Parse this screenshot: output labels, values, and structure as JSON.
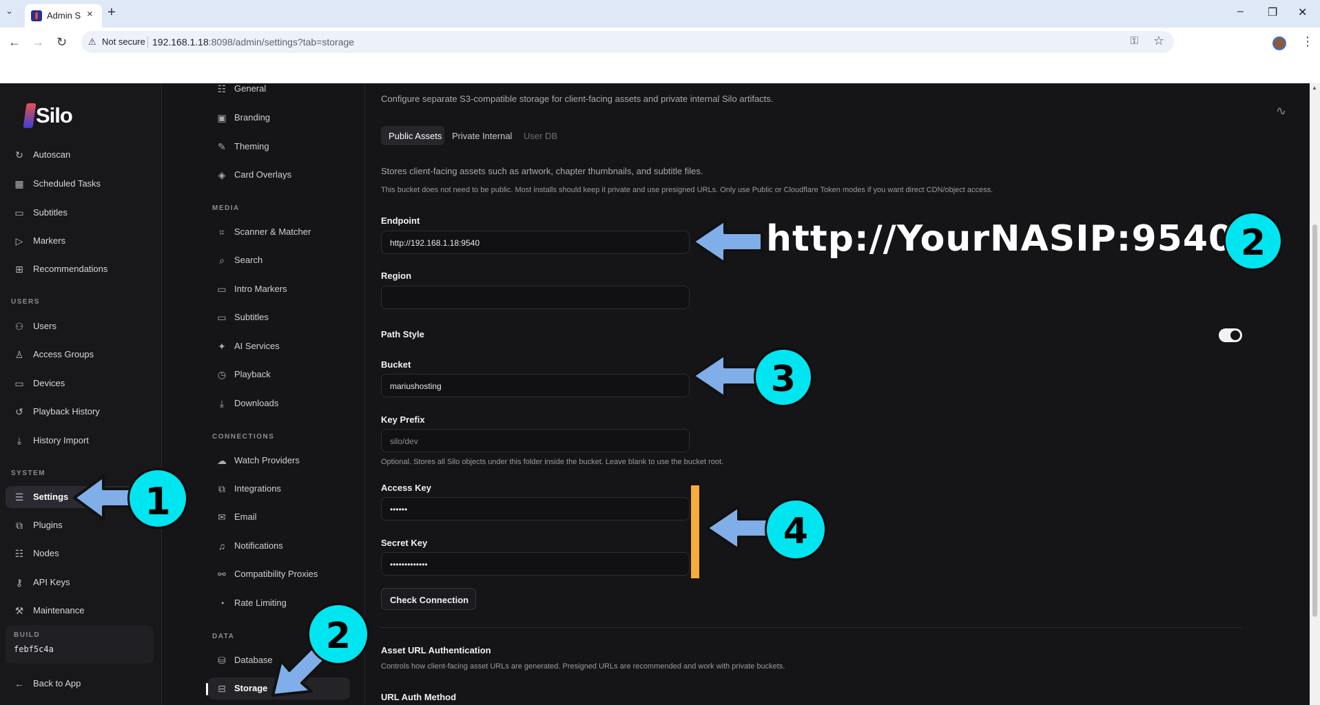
{
  "browser": {
    "tab_title": "Admin Si",
    "security_label": "Not secure",
    "url_host": "192.168.1.18",
    "url_rest": ":8098/admin/settings?tab=storage"
  },
  "app": {
    "brand": "Silo",
    "nav_items": [
      "Autoscan",
      "Scheduled Tasks",
      "Subtitles",
      "Markers",
      "Recommendations"
    ],
    "users_heading": "USERS",
    "users_items": [
      "Users",
      "Access Groups",
      "Devices",
      "Playback History",
      "History Import"
    ],
    "system_heading": "SYSTEM",
    "system_items": [
      "Settings",
      "Plugins",
      "Nodes",
      "API Keys",
      "Maintenance"
    ],
    "build_label": "BUILD",
    "build_value": "febf5c4a",
    "back_label": "Back to App"
  },
  "settings_nav": {
    "general_items": [
      "General",
      "Branding",
      "Theming",
      "Card Overlays"
    ],
    "media_heading": "MEDIA",
    "media_items": [
      "Scanner & Matcher",
      "Search",
      "Intro Markers",
      "Subtitles",
      "AI Services",
      "Playback",
      "Downloads"
    ],
    "connections_heading": "CONNECTIONS",
    "connections_items": [
      "Watch Providers",
      "Integrations",
      "Email",
      "Notifications",
      "Compatibility Proxies",
      "Rate Limiting"
    ],
    "data_heading": "DATA",
    "data_items": [
      "Database",
      "Storage"
    ]
  },
  "storage": {
    "intro": "Configure separate S3-compatible storage for client-facing assets and private internal Silo artifacts.",
    "tabs": [
      "Public Assets",
      "Private Internal",
      "User DB"
    ],
    "desc1": "Stores client-facing assets such as artwork, chapter thumbnails, and subtitle files.",
    "desc2": "This bucket does not need to be public. Most installs should keep it private and use presigned URLs. Only use Public or Cloudflare Token modes if you want direct CDN/object access.",
    "endpoint_label": "Endpoint",
    "endpoint_value": "http://192.168.1.18:9540",
    "region_label": "Region",
    "region_value": "",
    "path_style_label": "Path Style",
    "bucket_label": "Bucket",
    "bucket_value": "mariushosting",
    "prefix_label": "Key Prefix",
    "prefix_placeholder": "silo/dev",
    "prefix_help": "Optional. Stores all Silo objects under this folder inside the bucket. Leave blank to use the bucket root.",
    "access_label": "Access Key",
    "access_value": "••••••",
    "secret_label": "Secret Key",
    "secret_value": "•••••••••••••",
    "check_label": "Check Connection",
    "auth_title": "Asset URL Authentication",
    "auth_desc": "Controls how client-facing asset URLs are generated. Presigned URLs are recommended and work with private buckets.",
    "auth_method_label": "URL Auth Method"
  },
  "annotations": {
    "url_note": "http://YourNASIP:9540",
    "step1": "1",
    "step2a": "2",
    "step2b": "2",
    "step3": "3",
    "step4": "4",
    "arrow_color": "#7faee8",
    "circle_color": "#00e5ef",
    "bar_color": "#f7ad3c"
  }
}
